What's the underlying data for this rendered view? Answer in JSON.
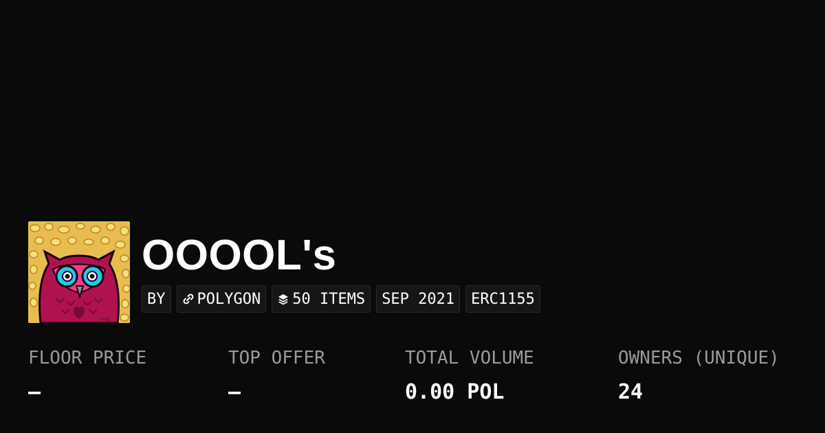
{
  "collection": {
    "title": "OOOOL's",
    "avatar_icon": "pink-owl-avatar"
  },
  "badges": {
    "by": "BY",
    "chain": "POLYGON",
    "chain_icon": "polygon-link-icon",
    "items": "50 ITEMS",
    "items_icon": "layers-icon",
    "date": "SEP 2021",
    "standard": "ERC1155"
  },
  "stats": [
    {
      "label": "FLOOR PRICE",
      "value": "—"
    },
    {
      "label": "TOP OFFER",
      "value": "—"
    },
    {
      "label": "TOTAL VOLUME",
      "value": "0.00 POL"
    },
    {
      "label": "OWNERS (UNIQUE)",
      "value": "24"
    }
  ],
  "colors": {
    "background": "#0a0a0a",
    "badge_background": "#161616",
    "label_gray": "#9a9a9a",
    "owl_magenta": "#c2185b",
    "owl_cyan": "#29c7e8",
    "leopard_gold": "#e6b94a"
  }
}
